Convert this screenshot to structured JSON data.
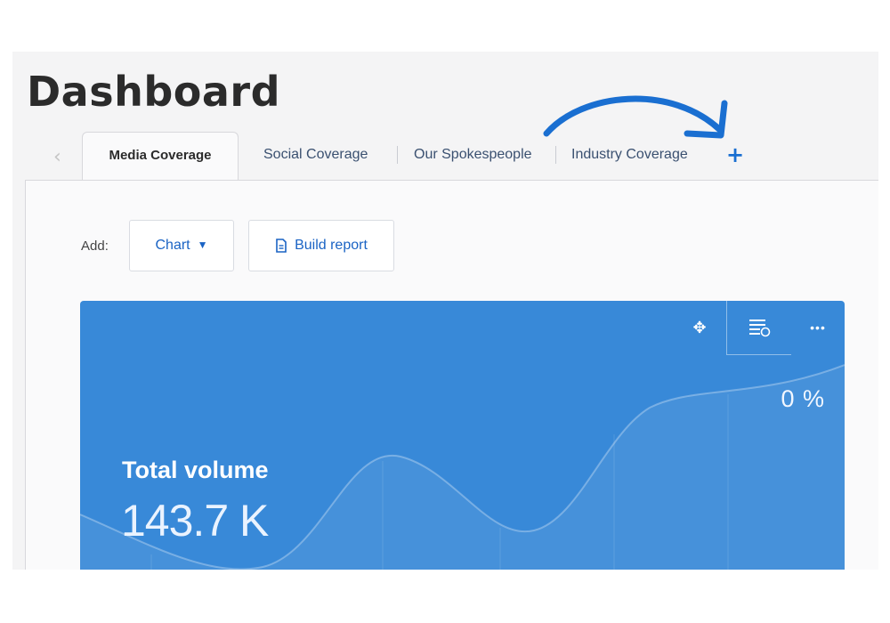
{
  "page": {
    "title": "Dashboard"
  },
  "tabs": {
    "items": [
      {
        "label": "Media Coverage",
        "active": true
      },
      {
        "label": "Social Coverage",
        "active": false
      },
      {
        "label": "Our Spokespeople",
        "active": false
      },
      {
        "label": "Industry Coverage",
        "active": false
      }
    ],
    "prev_icon": "chevron-left-icon",
    "add_icon": "plus-icon"
  },
  "toolbar": {
    "add_label": "Add:",
    "chart_label": "Chart",
    "build_report_label": "Build report"
  },
  "widget": {
    "title": "Total volume",
    "value": "143.7 K",
    "change": "0 %",
    "background_color": "#3889d8",
    "tool_icons": [
      "move-icon",
      "list-settings-icon",
      "more-icon"
    ]
  },
  "colors": {
    "accent": "#1a63c4",
    "annotation_arrow": "#1a6fd1"
  }
}
